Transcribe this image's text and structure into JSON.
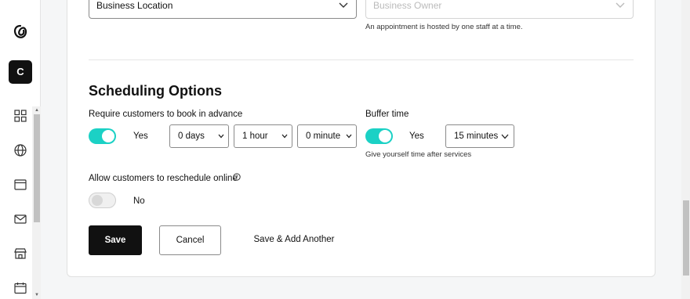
{
  "sidebar": {
    "avatar_letter": "C",
    "icons": [
      "godaddy-logo-icon",
      "grid-icon",
      "globe-icon",
      "browser-icon",
      "mail-icon",
      "store-icon",
      "calendar-icon"
    ]
  },
  "location": {
    "business_location": "Business Location",
    "business_owner_placeholder": "Business Owner",
    "owner_hint": "An appointment is hosted by one staff at a time."
  },
  "scheduling": {
    "title": "Scheduling Options",
    "advance_label": "Require customers to book in advance",
    "advance_toggle_text": "Yes",
    "advance_days": "0 days",
    "advance_hours": "1 hour",
    "advance_minutes": "0 minute",
    "buffer_label": "Buffer time",
    "buffer_toggle_text": "Yes",
    "buffer_value": "15 minutes",
    "buffer_hint": "Give yourself time after services",
    "reschedule_label": "Allow customers to reschedule online",
    "reschedule_toggle_text": "No"
  },
  "actions": {
    "save": "Save",
    "cancel": "Cancel",
    "save_add": "Save & Add Another"
  },
  "colors": {
    "toggle_on": "#1bd1c5",
    "primary": "#111111"
  }
}
